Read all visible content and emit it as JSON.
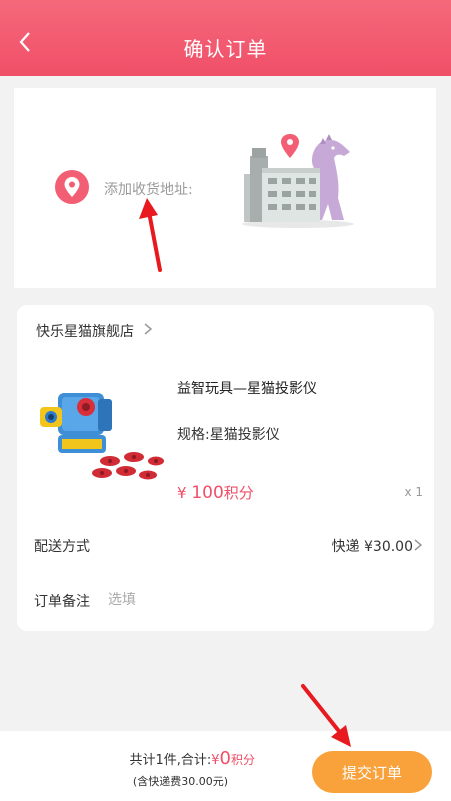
{
  "header": {
    "title": "确认订单",
    "back_icon": "chevron-left-icon"
  },
  "address": {
    "label": "添加收货地址:",
    "icon": "location-pin-icon"
  },
  "shop": {
    "name": "快乐星猫旗舰店"
  },
  "product": {
    "name": "益智玩具—星猫投影仪",
    "spec": "规格:星猫投影仪",
    "price_currency": "¥",
    "price_value": "100",
    "price_unit": "积分",
    "quantity": "x 1"
  },
  "shipping": {
    "label": "配送方式",
    "value": "快递 ¥30.00"
  },
  "note": {
    "label": "订单备注",
    "placeholder": "选填"
  },
  "footer": {
    "total_prefix": "共计1件,合计:",
    "total_currency": "¥",
    "total_amount": "0",
    "total_unit": "积分",
    "total_sub": "(含快递费30.00元)",
    "submit_label": "提交订单"
  },
  "colors": {
    "header": "#f04f68",
    "accent_price": "#f04f68",
    "submit": "#f9a13b",
    "annotation_arrow": "#e8191f"
  }
}
